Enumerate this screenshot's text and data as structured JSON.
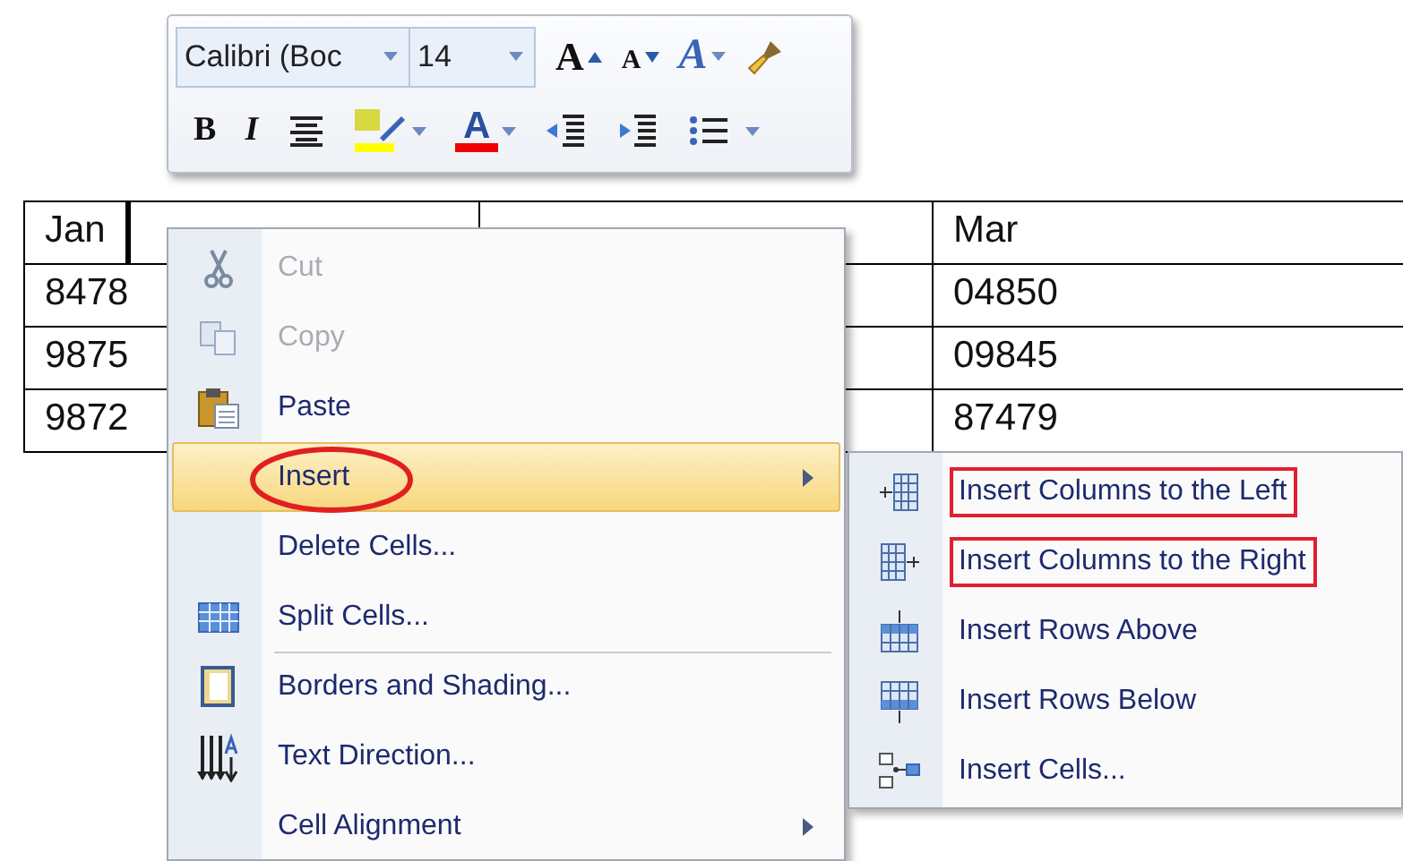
{
  "table": {
    "rows": [
      {
        "column_1": "Jan",
        "column_3": "Mar"
      },
      {
        "column_1": "8478",
        "column_3": "04850"
      },
      {
        "column_1": "9875",
        "column_3": "09845"
      },
      {
        "column_1": "9872",
        "column_3": "87479"
      }
    ]
  },
  "toolbar": {
    "font": "Calibri (Boc",
    "size": "14",
    "buttons": [
      {
        "kind": "grow",
        "label": "A"
      },
      {
        "kind": "shrink",
        "label": "A"
      },
      {
        "kind": "styles",
        "label": "A"
      },
      {
        "kind": "painter"
      },
      {
        "kind": "bold",
        "label": "B"
      },
      {
        "kind": "italic",
        "label": "I"
      },
      {
        "kind": "center"
      },
      {
        "kind": "highlight"
      },
      {
        "kind": "fontcolor",
        "label": "A"
      },
      {
        "kind": "outdent"
      },
      {
        "kind": "indent"
      },
      {
        "kind": "bullets"
      }
    ]
  },
  "context_menu": {
    "items": [
      {
        "label": "Cut",
        "disabled": true,
        "selected": false,
        "submenu": false,
        "separator_before": false,
        "annotated": false
      },
      {
        "label": "Copy",
        "disabled": true,
        "selected": false,
        "submenu": false,
        "separator_before": false,
        "annotated": false
      },
      {
        "label": "Paste",
        "disabled": false,
        "selected": false,
        "submenu": false,
        "separator_before": false,
        "annotated": false
      },
      {
        "label": "Insert",
        "disabled": false,
        "selected": true,
        "submenu": true,
        "separator_before": false,
        "annotated": true
      },
      {
        "label": "Delete Cells...",
        "disabled": false,
        "selected": false,
        "submenu": false,
        "separator_before": false,
        "annotated": false
      },
      {
        "label": "Split Cells...",
        "disabled": false,
        "selected": false,
        "submenu": false,
        "separator_before": false,
        "annotated": false
      },
      {
        "label": "Borders and Shading...",
        "disabled": false,
        "selected": false,
        "submenu": false,
        "separator_before": true,
        "annotated": false
      },
      {
        "label": "Text Direction...",
        "disabled": false,
        "selected": false,
        "submenu": false,
        "separator_before": false,
        "annotated": false
      },
      {
        "label": "Cell Alignment",
        "disabled": false,
        "selected": false,
        "submenu": true,
        "separator_before": false,
        "annotated": false
      }
    ]
  },
  "insert_submenu": {
    "items": [
      {
        "label": "Insert Columns to the Left",
        "disabled": false,
        "selected": false,
        "submenu": false,
        "separator_before": false,
        "annotated": true
      },
      {
        "label": "Insert Columns to the Right",
        "disabled": false,
        "selected": false,
        "submenu": false,
        "separator_before": false,
        "annotated": true
      },
      {
        "label": "Insert Rows Above",
        "disabled": false,
        "selected": false,
        "submenu": false,
        "separator_before": false,
        "annotated": false
      },
      {
        "label": "Insert Rows Below",
        "disabled": false,
        "selected": false,
        "submenu": false,
        "separator_before": false,
        "annotated": false
      },
      {
        "label": "Insert Cells...",
        "disabled": false,
        "selected": false,
        "submenu": false,
        "separator_before": false,
        "annotated": false
      }
    ]
  }
}
